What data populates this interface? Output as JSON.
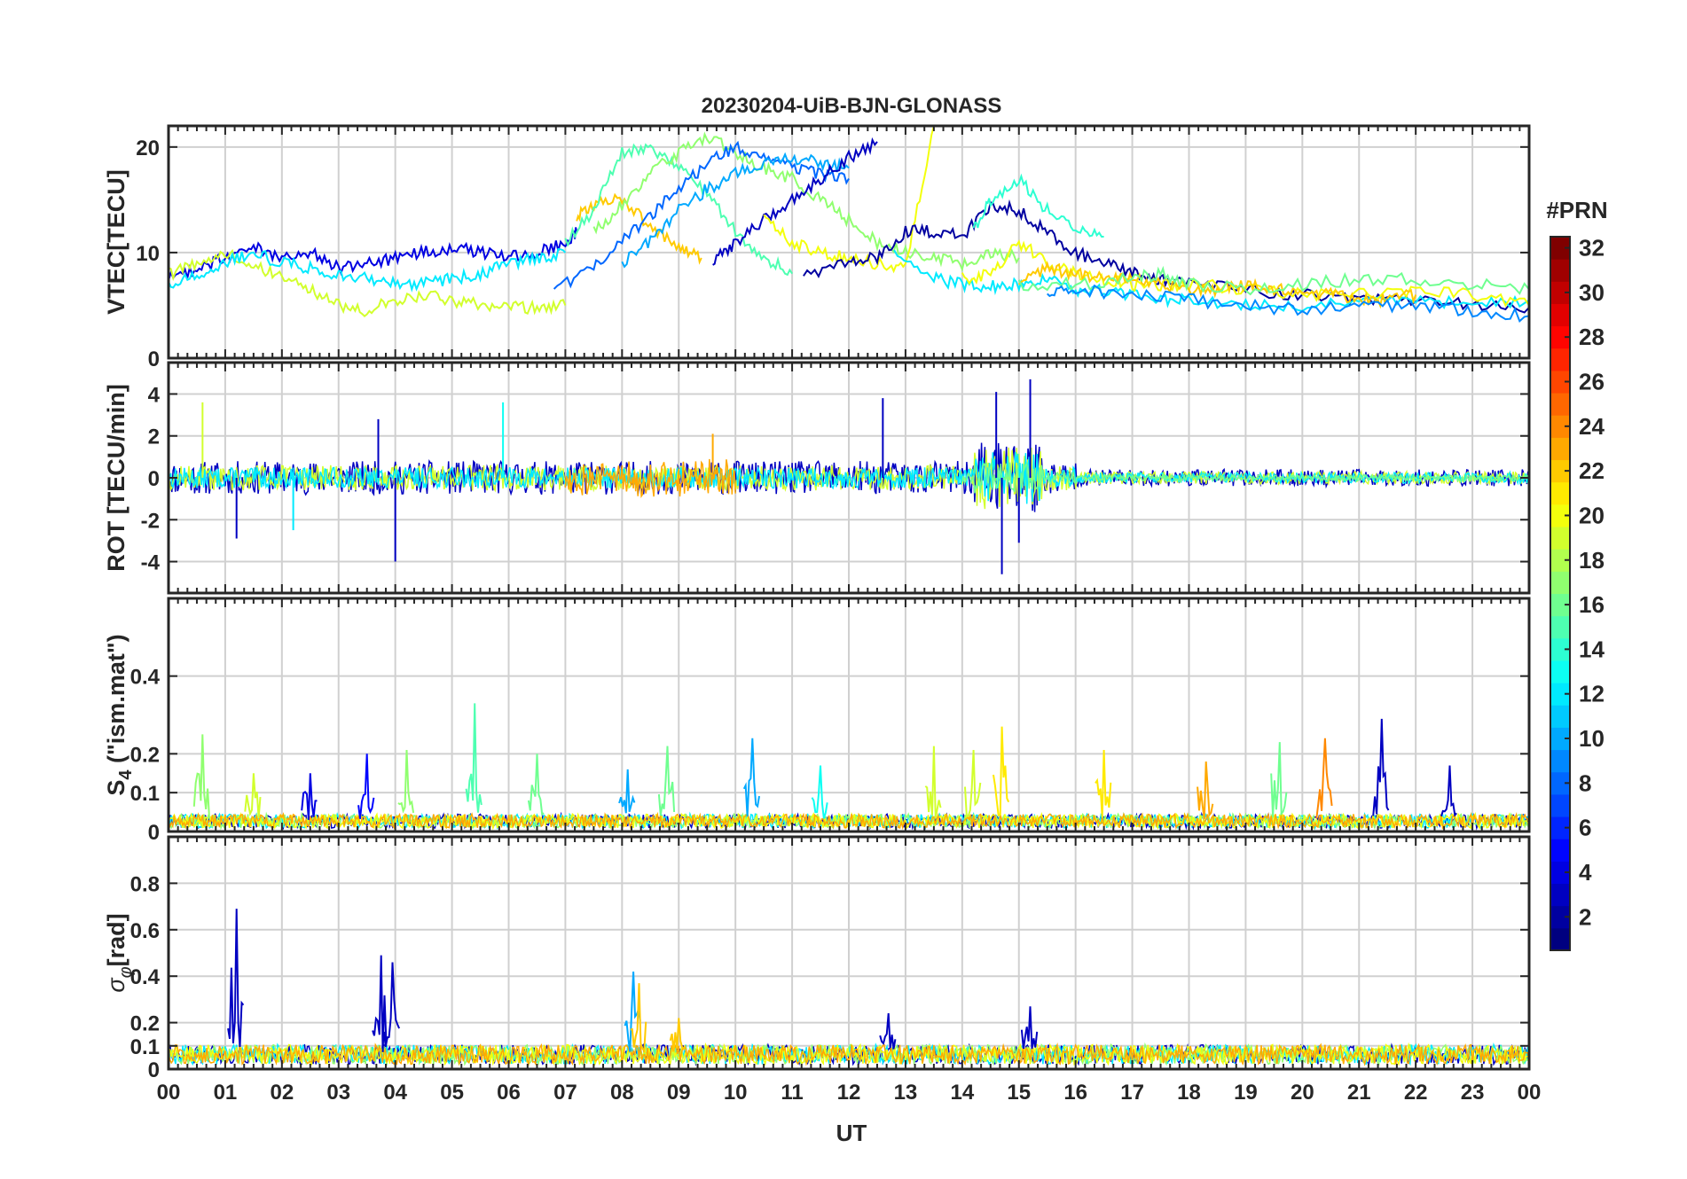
{
  "figure": {
    "title": "20230204-UiB-BJN-GLONASS",
    "xlabel": "UT"
  },
  "chart_data": [
    {
      "type": "line",
      "panel": "vtec",
      "ylabel": "VTEC[TECU]",
      "ylim": [
        0,
        22
      ],
      "yticks": [
        0,
        10,
        20
      ],
      "xlim": [
        0,
        24
      ],
      "grid": true,
      "series": [
        {
          "prn": 4,
          "x": [
            0,
            0.5,
            1,
            1.5,
            2,
            2.5,
            3,
            3.5,
            4,
            4.5,
            5,
            5.5,
            6,
            6.5,
            7,
            7.2
          ],
          "y": [
            7.5,
            8.5,
            9.5,
            10.5,
            9.5,
            10,
            8.5,
            9,
            9.5,
            10,
            10.5,
            10,
            9.5,
            10,
            11,
            12
          ]
        },
        {
          "prn": 19,
          "x": [
            0,
            0.5,
            1,
            1.5,
            2,
            2.5,
            3,
            3.5,
            4,
            4.5,
            5,
            5.5,
            6,
            6.5,
            7
          ],
          "y": [
            8,
            9,
            10,
            9,
            7.5,
            6.5,
            5,
            4.5,
            5.5,
            6,
            5.5,
            5,
            4.8,
            4.8,
            5
          ]
        },
        {
          "prn": 12,
          "x": [
            0,
            0.5,
            1,
            1.5,
            2,
            2.5,
            3,
            3.5,
            4,
            4.5,
            5,
            5.5,
            6,
            6.5,
            7
          ],
          "y": [
            7,
            8,
            9,
            10,
            9,
            8.5,
            8,
            7.5,
            7,
            7,
            7.5,
            8,
            9,
            9.5,
            10
          ]
        },
        {
          "prn": 22,
          "x": [
            7.2,
            7.5,
            8,
            8.5,
            9,
            9.4
          ],
          "y": [
            13.5,
            14.5,
            15,
            12.5,
            10.5,
            9.5
          ]
        },
        {
          "prn": 15,
          "x": [
            7,
            7.5,
            8,
            8.5,
            9,
            9.5,
            10,
            10.5,
            11
          ],
          "y": [
            11,
            14,
            19.5,
            20,
            18,
            15.5,
            12,
            9.5,
            8
          ]
        },
        {
          "prn": 17,
          "x": [
            7.5,
            8,
            8.5,
            9,
            9.5,
            10,
            10.5,
            11,
            11.5,
            12,
            12.5,
            13,
            13.5,
            14,
            14.5,
            15
          ],
          "y": [
            12,
            14.5,
            17.5,
            19.5,
            21,
            19.5,
            18,
            17,
            15,
            13,
            11,
            10,
            9.5,
            9,
            10,
            9.5
          ]
        },
        {
          "prn": 8,
          "x": [
            6.8,
            7.5,
            8,
            8.5,
            9,
            9.5,
            10,
            10.5,
            11,
            11.5,
            12
          ],
          "y": [
            6.5,
            8.5,
            11,
            13.5,
            16,
            18.5,
            20,
            19,
            18,
            17.5,
            17
          ]
        },
        {
          "prn": 10,
          "x": [
            8,
            8.5,
            9,
            9.5,
            10,
            10.5,
            11,
            11.5,
            12
          ],
          "y": [
            9,
            11,
            14,
            16,
            17.5,
            18.5,
            19,
            18.5,
            18
          ]
        },
        {
          "prn": 3,
          "x": [
            9.6,
            10,
            10.5,
            11,
            11.5,
            12,
            12.5
          ],
          "y": [
            9,
            11,
            13,
            15,
            17,
            19,
            20.5
          ]
        },
        {
          "prn": 20,
          "x": [
            10.5,
            11,
            11.5,
            12,
            12.5,
            13,
            13.5
          ],
          "y": [
            13,
            11,
            10,
            9.5,
            9,
            8.5,
            22
          ]
        },
        {
          "prn": 2,
          "x": [
            11.2,
            12,
            12.5,
            13,
            13.5,
            14,
            14.5,
            15,
            15.5,
            16,
            16.5,
            17,
            17.5,
            18,
            19,
            20,
            21,
            22,
            23,
            24
          ],
          "y": [
            8,
            9,
            9.5,
            12,
            12,
            11.5,
            14.5,
            14,
            12,
            10,
            9,
            8,
            7.5,
            7,
            6.5,
            6,
            5.5,
            5.5,
            5,
            4.8
          ]
        },
        {
          "prn": 12,
          "x": [
            12.8,
            13.5,
            14,
            14.5,
            15,
            15.5,
            16,
            16.5,
            17,
            17.5,
            18,
            19,
            20,
            21,
            22,
            23,
            24
          ],
          "y": [
            10,
            7.5,
            7,
            6.8,
            7,
            7.5,
            6.5,
            6.3,
            6,
            5.5,
            5.5,
            5,
            5,
            5.5,
            5.5,
            5,
            5.5
          ]
        },
        {
          "prn": 20,
          "x": [
            14,
            14.5,
            15,
            15.5,
            16,
            16.5,
            17,
            17.5,
            18,
            19,
            20,
            21,
            22,
            23,
            24
          ],
          "y": [
            7.5,
            8,
            11,
            9,
            8,
            7.5,
            7,
            7,
            7,
            6.5,
            6,
            6,
            6.5,
            6,
            5
          ]
        },
        {
          "prn": 22,
          "x": [
            15,
            15.5,
            16,
            16.5,
            17,
            17.5,
            18,
            18.5,
            19,
            19.5,
            20,
            20.5,
            21,
            21.5,
            22
          ],
          "y": [
            7.5,
            8.5,
            8,
            7.5,
            7.5,
            7,
            6.5,
            6.5,
            7,
            6.5,
            6.5,
            6,
            5.5,
            5.5,
            6
          ]
        },
        {
          "prn": 16,
          "x": [
            15,
            16,
            17,
            17.5,
            18,
            19,
            20,
            21,
            22,
            23,
            24
          ],
          "y": [
            7,
            7,
            7.5,
            8,
            7,
            6.5,
            7,
            7.5,
            7.5,
            7,
            6.5
          ]
        },
        {
          "prn": 9,
          "x": [
            15.5,
            16,
            17,
            18,
            19,
            20,
            21,
            22,
            23,
            24
          ],
          "y": [
            6,
            6.5,
            6,
            5.5,
            5,
            4.5,
            5,
            5,
            4.5,
            4
          ]
        },
        {
          "prn": 14,
          "x": [
            14.2,
            14.5,
            15,
            15.5,
            16,
            16.5
          ],
          "y": [
            12,
            15,
            17,
            14,
            12,
            11.5
          ]
        }
      ]
    },
    {
      "type": "line",
      "panel": "rot",
      "ylabel": "ROT [TECU/min]",
      "ylim": [
        -5.5,
        5.5
      ],
      "yticks": [
        -4,
        -2,
        0,
        2,
        4
      ],
      "xlim": [
        0,
        24
      ],
      "grid": true,
      "noisy_series": [
        {
          "prn": 3,
          "x": [
            0,
            24
          ],
          "amp": 0.8,
          "seed": 11
        },
        {
          "prn": 19,
          "x": [
            0,
            24
          ],
          "amp": 0.6,
          "seed": 12
        },
        {
          "prn": 12,
          "x": [
            0,
            24
          ],
          "amp": 0.5,
          "seed": 13
        },
        {
          "prn": 23,
          "x": [
            7,
            10
          ],
          "amp": 0.9,
          "seed": 14
        },
        {
          "prn": 16,
          "x": [
            14,
            24
          ],
          "amp": 0.3,
          "seed": 15
        }
      ],
      "spikes": [
        {
          "x": 0.6,
          "y": 3.6,
          "prn": 19
        },
        {
          "x": 3.7,
          "y": 2.8,
          "prn": 3
        },
        {
          "x": 4.0,
          "y": -4.0,
          "prn": 3
        },
        {
          "x": 5.9,
          "y": 3.6,
          "prn": 13
        },
        {
          "x": 9.6,
          "y": 2.1,
          "prn": 23
        },
        {
          "x": 12.6,
          "y": 3.8,
          "prn": 3
        },
        {
          "x": 14.6,
          "y": 4.1,
          "prn": 3
        },
        {
          "x": 14.7,
          "y": -4.6,
          "prn": 3
        },
        {
          "x": 15.2,
          "y": 4.7,
          "prn": 3
        },
        {
          "x": 15.0,
          "y": -3.1,
          "prn": 3
        },
        {
          "x": 1.2,
          "y": -2.9,
          "prn": 3
        },
        {
          "x": 2.2,
          "y": -2.5,
          "prn": 12
        }
      ]
    },
    {
      "type": "line",
      "panel": "s4",
      "ylabel": "S4 (\"ism.mat\")",
      "ylim": [
        0,
        0.6
      ],
      "yticks": [
        0,
        0.1,
        0.2,
        0.4
      ],
      "xlim": [
        0,
        24
      ],
      "grid": true,
      "baseline": 0.03,
      "bursts": [
        {
          "x": 0.6,
          "y": 0.25,
          "prn": 17
        },
        {
          "x": 1.5,
          "y": 0.15,
          "prn": 19
        },
        {
          "x": 2.5,
          "y": 0.15,
          "prn": 4
        },
        {
          "x": 3.5,
          "y": 0.2,
          "prn": 5
        },
        {
          "x": 4.2,
          "y": 0.21,
          "prn": 17
        },
        {
          "x": 5.4,
          "y": 0.33,
          "prn": 15
        },
        {
          "x": 6.5,
          "y": 0.2,
          "prn": 16
        },
        {
          "x": 8.1,
          "y": 0.16,
          "prn": 10
        },
        {
          "x": 8.8,
          "y": 0.22,
          "prn": 16
        },
        {
          "x": 10.3,
          "y": 0.24,
          "prn": 10
        },
        {
          "x": 11.5,
          "y": 0.17,
          "prn": 13
        },
        {
          "x": 13.5,
          "y": 0.22,
          "prn": 19
        },
        {
          "x": 14.2,
          "y": 0.21,
          "prn": 19
        },
        {
          "x": 14.7,
          "y": 0.27,
          "prn": 21
        },
        {
          "x": 16.5,
          "y": 0.21,
          "prn": 21
        },
        {
          "x": 18.3,
          "y": 0.18,
          "prn": 23
        },
        {
          "x": 19.6,
          "y": 0.23,
          "prn": 16
        },
        {
          "x": 20.4,
          "y": 0.24,
          "prn": 24
        },
        {
          "x": 21.4,
          "y": 0.29,
          "prn": 3
        },
        {
          "x": 22.6,
          "y": 0.17,
          "prn": 3
        }
      ]
    },
    {
      "type": "line",
      "panel": "sigma_phi",
      "ylabel": "σφ[rad]",
      "ylim": [
        0,
        1
      ],
      "yticks": [
        0,
        0.1,
        0.2,
        0.4,
        0.6,
        0.8
      ],
      "xlim": [
        0,
        24
      ],
      "grid": true,
      "baseline": 0.07,
      "bursts": [
        {
          "x": 1.2,
          "y": 0.69,
          "prn": 3
        },
        {
          "x": 3.75,
          "y": 0.49,
          "prn": 3
        },
        {
          "x": 3.95,
          "y": 0.46,
          "prn": 3
        },
        {
          "x": 8.2,
          "y": 0.42,
          "prn": 10
        },
        {
          "x": 8.3,
          "y": 0.37,
          "prn": 22
        },
        {
          "x": 9.0,
          "y": 0.22,
          "prn": 22
        },
        {
          "x": 12.7,
          "y": 0.24,
          "prn": 3
        },
        {
          "x": 15.2,
          "y": 0.27,
          "prn": 3
        }
      ]
    },
    {
      "type": "colorbar",
      "label": "#PRN",
      "range": [
        1,
        32
      ],
      "ticks": [
        2,
        4,
        6,
        8,
        10,
        12,
        14,
        16,
        18,
        20,
        22,
        24,
        26,
        28,
        30,
        32
      ]
    }
  ],
  "x_ticks": [
    "00",
    "01",
    "02",
    "03",
    "04",
    "05",
    "06",
    "07",
    "08",
    "09",
    "10",
    "11",
    "12",
    "13",
    "14",
    "15",
    "16",
    "17",
    "18",
    "19",
    "20",
    "21",
    "22",
    "23",
    "00"
  ]
}
